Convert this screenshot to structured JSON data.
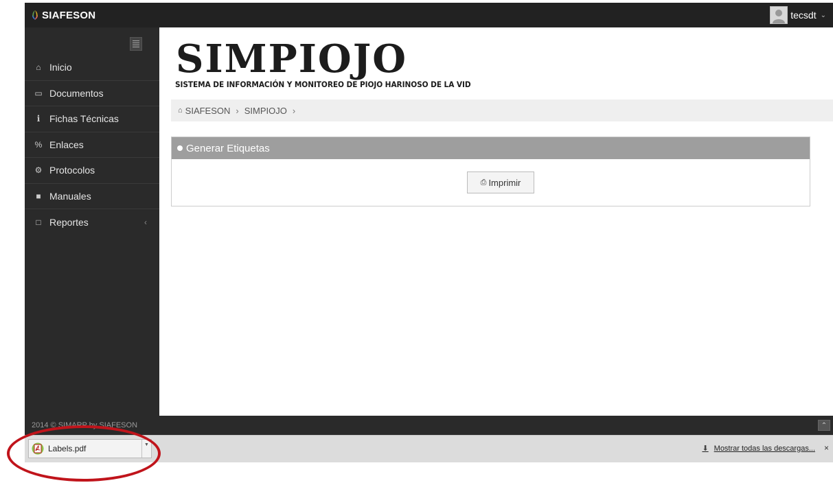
{
  "brand": {
    "name": "SIAFESON"
  },
  "user": {
    "name": "tecsdt"
  },
  "sidebar": {
    "items": [
      {
        "label": "Inicio",
        "icon": "home-icon",
        "glyph": "⌂"
      },
      {
        "label": "Documentos",
        "icon": "folder-icon",
        "glyph": "▭"
      },
      {
        "label": "Fichas Técnicas",
        "icon": "info-icon",
        "glyph": "i"
      },
      {
        "label": "Enlaces",
        "icon": "link-icon",
        "glyph": "%"
      },
      {
        "label": "Protocolos",
        "icon": "gear-icon",
        "glyph": "⚙"
      },
      {
        "label": "Manuales",
        "icon": "book-icon",
        "glyph": "■"
      },
      {
        "label": "Reportes",
        "icon": "file-icon",
        "glyph": "□"
      }
    ]
  },
  "page": {
    "logo": "SIMPIOJO",
    "subtitle": "SISTEMA DE INFORMACIÓN Y MONITOREO DE PIOJO HARINOSO DE LA VID"
  },
  "breadcrumb": {
    "items": [
      "SIAFESON",
      "SIMPIOJO"
    ]
  },
  "panel": {
    "title": "Generar Etiquetas",
    "print_label": "Imprimir"
  },
  "footer": {
    "text": "2014 © SIMARP by SIAFESON"
  },
  "downloads": {
    "file": "Labels.pdf",
    "show_all": "Mostrar todas las descargas...",
    "close": "×"
  },
  "colors": {
    "topbar": "#222222",
    "sidebar": "#2a2a2a",
    "panel_header": "#9e9e9e",
    "annotation": "#c0141b"
  }
}
